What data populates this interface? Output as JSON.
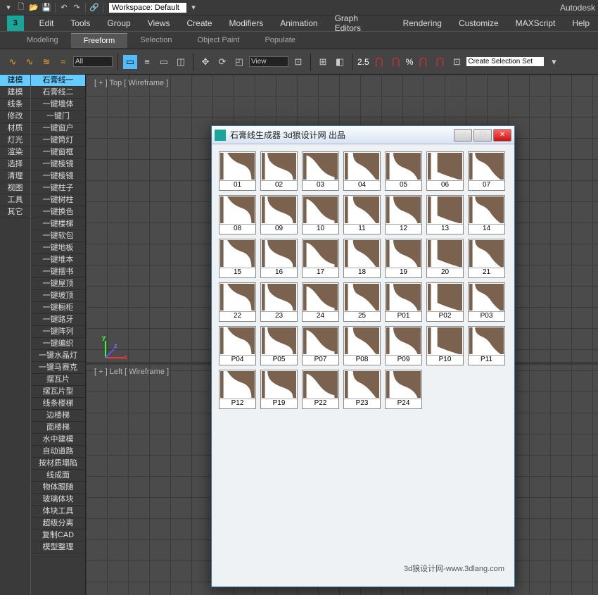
{
  "brand": "Autodesk",
  "workspace_label": "Workspace: Default",
  "menus": [
    "Edit",
    "Tools",
    "Group",
    "Views",
    "Create",
    "Modifiers",
    "Animation",
    "Graph Editors",
    "Rendering",
    "Customize",
    "MAXScript",
    "Help"
  ],
  "ribbon_tabs": [
    "Modeling",
    "Freeform",
    "Selection",
    "Object Paint",
    "Populate"
  ],
  "ribbon_active": "Freeform",
  "toolbar": {
    "filter_all": "All",
    "view_label": "View",
    "spinner": "2.5",
    "percent": "%",
    "selection_set": "Create Selection Set"
  },
  "side_colA": [
    "建模",
    "建模",
    "线条",
    "修改",
    "材质",
    "灯光",
    "渲染",
    "选择",
    "清理",
    "视图",
    "工具",
    "其它"
  ],
  "side_colB": [
    "石膏线一",
    "石膏线二",
    "一键墙体",
    "一键门",
    "一键窗户",
    "一键筒灯",
    "一键窗框",
    "一键棱镜",
    "一键棱镜",
    "一键柱子",
    "一键树柱",
    "一键换色",
    "一键楼梯",
    "一键软包",
    "一键地板",
    "一键堆本",
    "一键摆书",
    "一键屋顶",
    "一键坡顶",
    "一键橱柜",
    "一键路牙",
    "一键阵列",
    "一键编织",
    "一键水晶灯",
    "一键马赛克",
    "摆瓦片",
    "摆瓦片型",
    "线条楼梯",
    "边楼梯",
    "面楼梯",
    "水中建模",
    "自动道路",
    "按材质塌陷",
    "线成面",
    "物体跟随",
    "玻璃体块",
    "体块工具",
    "超级分离",
    "复制CAD",
    "模型整理"
  ],
  "side_selectedA": 0,
  "side_selectedB": 0,
  "viewport_top": "[ + ] Top  [ Wireframe ]",
  "viewport_left": "[ + ] Left  [ Wireframe ]",
  "dialog": {
    "title": "石膏线生成器 3d狼设计网 出品",
    "footer": "3d狼设计网-www.3dlang.com",
    "profiles": [
      "01",
      "02",
      "03",
      "04",
      "05",
      "06",
      "07",
      "08",
      "09",
      "10",
      "11",
      "12",
      "13",
      "14",
      "15",
      "16",
      "17",
      "18",
      "19",
      "20",
      "21",
      "22",
      "23",
      "24",
      "25",
      "P01",
      "P02",
      "P03",
      "P04",
      "P05",
      "P07",
      "P08",
      "P09",
      "P10",
      "P11",
      "P12",
      "P19",
      "P22",
      "P23",
      "P24"
    ]
  }
}
